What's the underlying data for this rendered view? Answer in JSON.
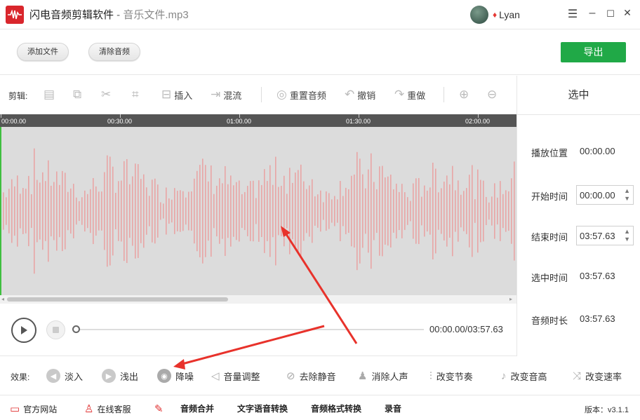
{
  "titlebar": {
    "app_name": "闪电音频剪辑软件",
    "separator": " - ",
    "file_name": "音乐文件.mp3",
    "username": "Lyan",
    "minimize": "–",
    "maximize": "☐",
    "close": "✕",
    "menu": "☰"
  },
  "actions": {
    "add_file": "添加文件",
    "clear_audio": "清除音频",
    "export": "导出"
  },
  "edit_toolbar": {
    "label": "剪辑:",
    "insert": "插入",
    "mix": "混流",
    "reset_audio": "重置音频",
    "undo": "撤销",
    "redo": "重做"
  },
  "timeline": {
    "labels": [
      "00:00.00",
      "00:30.00",
      "01:00.00",
      "01:30.00",
      "02:00.00"
    ]
  },
  "waveform": {
    "bar_color": "#e8a5a5",
    "background": "#dcdcdc",
    "cursor_color": "#3fbf3f"
  },
  "right_panel": {
    "title": "选中",
    "play_position_label": "播放位置",
    "play_position_value": "00:00.00",
    "start_time_label": "开始时间",
    "start_time_value": "00:00.00",
    "end_time_label": "结束时间",
    "end_time_value": "03:57.63",
    "selected_time_label": "选中时间",
    "selected_time_value": "03:57.63",
    "duration_label": "音频时长",
    "duration_value": "03:57.63"
  },
  "playback": {
    "time_display": "00:00.00/03:57.63",
    "progress": 0
  },
  "effects": {
    "label": "效果:",
    "fade_in": "淡入",
    "fade_out": "浅出",
    "denoise": "降噪",
    "volume": "音量调整",
    "remove_silence": "去除静音",
    "remove_vocals": "消除人声",
    "change_tempo": "改变节奏",
    "change_pitch": "改变音高",
    "change_speed": "改变速率"
  },
  "bottom_bar": {
    "website": "官方网站",
    "support": "在线客服",
    "merge": "音频合并",
    "tts": "文字语音转换",
    "format_convert": "音频格式转换",
    "record": "录音",
    "version": "版本：v3.1.1"
  },
  "colors": {
    "accent_green": "#20a947",
    "logo_red": "#d9262c",
    "annotation_red": "#e8322b"
  }
}
